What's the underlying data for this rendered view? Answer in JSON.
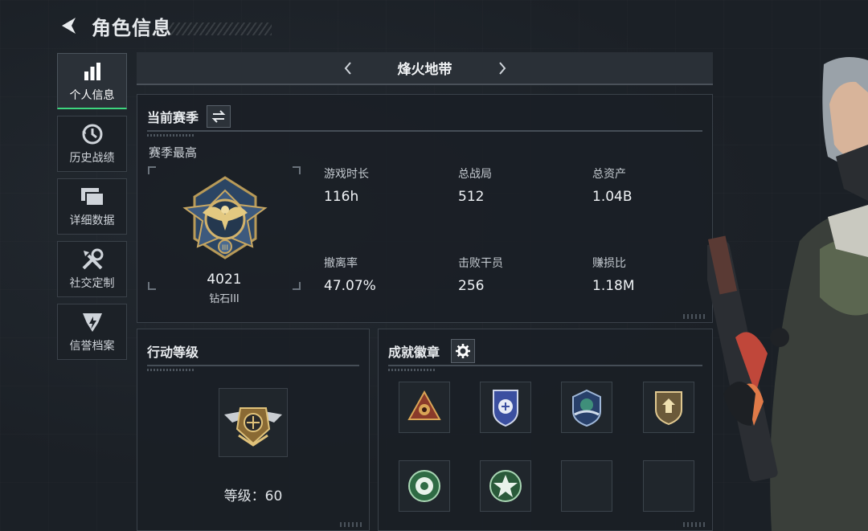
{
  "header": {
    "title": "角色信息"
  },
  "sidebar": {
    "items": [
      {
        "label": "个人信息",
        "icon": "bar-chart-icon",
        "active": true
      },
      {
        "label": "历史战绩",
        "icon": "history-clock-icon",
        "active": false
      },
      {
        "label": "详细数据",
        "icon": "stacked-cards-icon",
        "active": false
      },
      {
        "label": "社交定制",
        "icon": "tools-icon",
        "active": false
      },
      {
        "label": "信誉档案",
        "icon": "shield-badge-icon",
        "active": false
      }
    ]
  },
  "mode_selector": {
    "name": "烽火地带",
    "prev_icon": "chevron-left-icon",
    "next_icon": "chevron-right-icon"
  },
  "season": {
    "title": "当前赛季",
    "subtitle": "赛季最高",
    "rank_score": "4021",
    "rank_tier": "钻石III",
    "stats": [
      {
        "label": "游戏时长",
        "value": "116h"
      },
      {
        "label": "总战局",
        "value": "512"
      },
      {
        "label": "总资产",
        "value": "1.04B"
      },
      {
        "label": "撤离率",
        "value": "47.07%"
      },
      {
        "label": "击败干员",
        "value": "256"
      },
      {
        "label": "赚损比",
        "value": "1.18M"
      }
    ]
  },
  "action_level": {
    "title": "行动等级",
    "level_text": "等级：60"
  },
  "achievements": {
    "title": "成就徽章",
    "badges": [
      "triangle-eye-badge",
      "blue-shield-badge",
      "navy-wing-badge",
      "gold-shield-badge",
      "green-flower-badge",
      "green-star-badge",
      "empty",
      "empty"
    ]
  },
  "colors": {
    "accent": "#3dd67e",
    "background": "#1b2026",
    "panel_border": "#3a4149"
  }
}
